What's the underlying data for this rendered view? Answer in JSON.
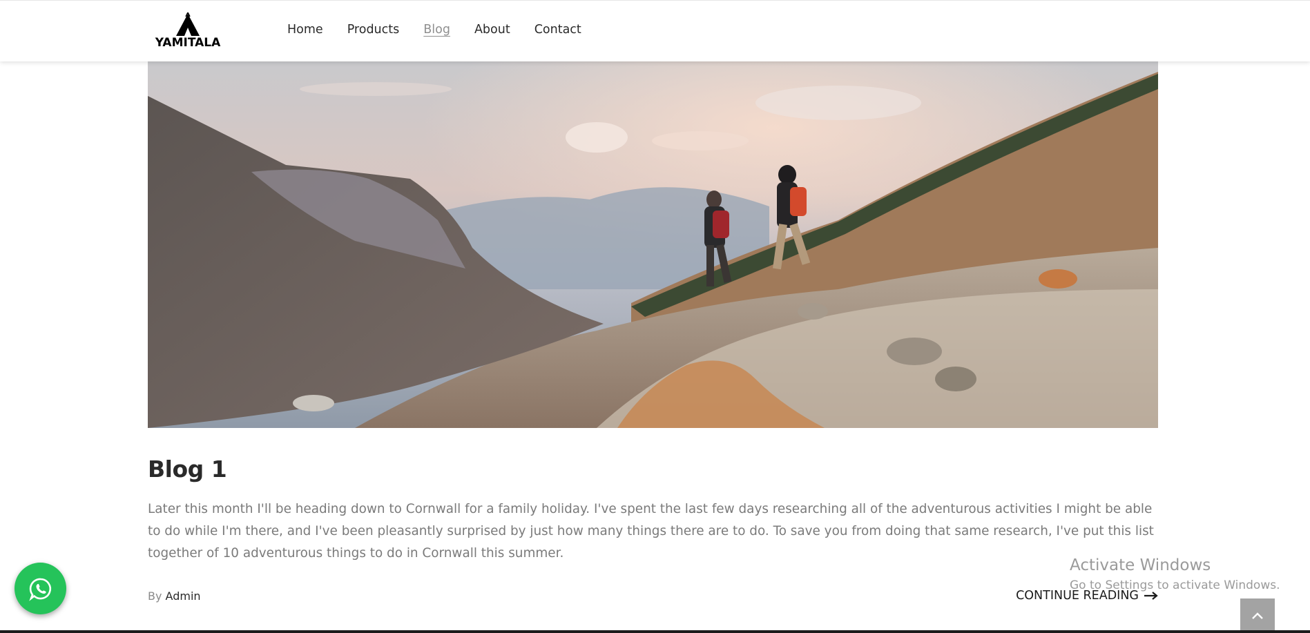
{
  "header": {
    "logo_text": "YAMITALA",
    "nav": [
      {
        "label": "Home"
      },
      {
        "label": "Products"
      },
      {
        "label": "Blog"
      },
      {
        "label": "About"
      },
      {
        "label": "Contact"
      }
    ],
    "active_nav": "Blog"
  },
  "post": {
    "title": "Blog 1",
    "excerpt": "Later this month I'll be heading down to Cornwall for a family holiday. I've spent the last few days researching all of the adventurous activities I might be able to do while I'm there, and I've been pleasantly surprised by just how many things there are to do. To save you from doing that same research, I've put this list together of 10 adventurous things to do in Cornwall this summer.",
    "by_label": "By",
    "author": "Admin",
    "continue_label": "CONTINUE READING"
  },
  "watermark": {
    "line1": "Activate Windows",
    "line2": "Go to Settings to activate Windows."
  },
  "icons": {
    "whatsapp": "whatsapp-icon",
    "scroll_top": "chevron-up-icon",
    "continue_arrow": "arrow-right-icon"
  },
  "colors": {
    "whatsapp_green": "#25c35a",
    "active_nav": "#8f8f8f",
    "scroll_top_bg": "#a3a3a3"
  }
}
